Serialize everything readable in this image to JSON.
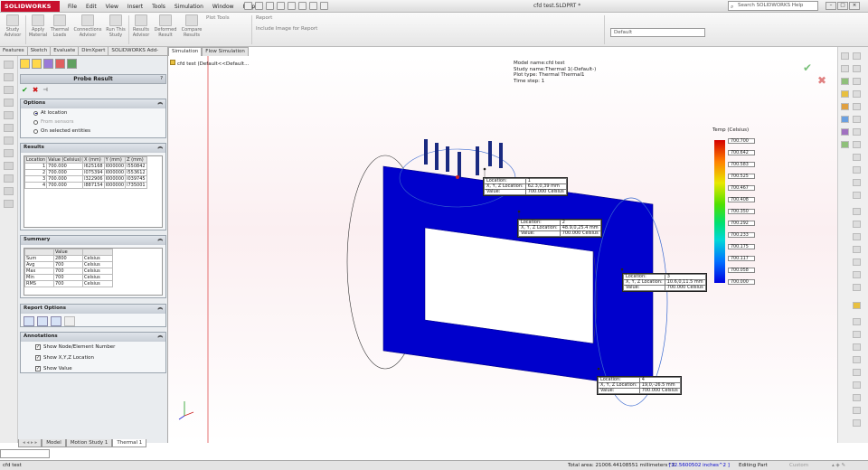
{
  "app": {
    "logo": "SOLIDWORKS",
    "doc_title": "cfd test.SLDPRT *"
  },
  "menu": [
    "File",
    "Edit",
    "View",
    "Insert",
    "Tools",
    "Simulation",
    "Window",
    "Help"
  ],
  "search": {
    "placeholder": "Search SOLIDWORKS Help"
  },
  "ribbon": {
    "buttons": [
      {
        "label": "Study Advisor"
      },
      {
        "label": "Apply Material"
      },
      {
        "label": "Thermal Loads"
      },
      {
        "label": "Connections Advisor"
      },
      {
        "label": "Run This Study"
      },
      {
        "label": "Results Advisor"
      },
      {
        "label": "Deformed Result"
      },
      {
        "label": "Compare Results"
      }
    ],
    "plot_tools": "Plot Tools",
    "report": "Report",
    "include_image": "Include Image for Report",
    "config_combo": "Default"
  },
  "manager_tabs": [
    "Features",
    "Sketch",
    "Evaluate",
    "DimXpert",
    "SOLIDWORKS Add-Ins"
  ],
  "graphics_tabs": [
    "Simulation",
    "Flow Simulation"
  ],
  "panel": {
    "title": "Probe Result",
    "help": "?",
    "ok": "✔",
    "cancel": "✖",
    "pin": "⊣",
    "options": {
      "header": "Options",
      "items": [
        {
          "label": "At location",
          "selected": true,
          "enabled": true
        },
        {
          "label": "From sensors",
          "selected": false,
          "enabled": false
        },
        {
          "label": "On selected entities",
          "selected": false,
          "enabled": true
        }
      ]
    },
    "results": {
      "header": "Results",
      "columns": [
        "Location",
        "Value (Celsius)",
        "X (mm)",
        "Y (mm)",
        "Z (mm)"
      ],
      "rows": [
        [
          "1",
          "700.000",
          "l625168",
          "l000000",
          "l550842"
        ],
        [
          "2",
          "700.000",
          "l075394",
          "l000000",
          "l553612"
        ],
        [
          "3",
          "700.000",
          "l322906",
          "l000000",
          "l039745"
        ],
        [
          "4",
          "700.000",
          "l887154",
          "l000000",
          "l735001"
        ]
      ]
    },
    "summary": {
      "header": "Summary",
      "columns": [
        "",
        "Value",
        ""
      ],
      "rows": [
        [
          "Sum",
          "2800",
          "Celsius"
        ],
        [
          "Avg",
          "700",
          "Celsius"
        ],
        [
          "Max",
          "700",
          "Celsius"
        ],
        [
          "Min",
          "700",
          "Celsius"
        ],
        [
          "RMS",
          "700",
          "Celsius"
        ]
      ]
    },
    "report_options": {
      "header": "Report Options"
    },
    "annotations": {
      "header": "Annotations",
      "items": [
        {
          "label": "Show Node/Element Number",
          "checked": true
        },
        {
          "label": "Show X,Y,Z Location",
          "checked": true
        },
        {
          "label": "Show Value",
          "checked": true
        }
      ]
    }
  },
  "feature_tree": {
    "root": "cfd test",
    "config": "(Default<<Default..."
  },
  "model_info": [
    "Model name:cfd test",
    "Study name:Thermal 1(-Default-)",
    "Plot type: Thermal Thermal1",
    "Time step: 1"
  ],
  "legend": {
    "title": "Temp (Celsius)",
    "values": [
      "700.700",
      "700.642",
      "700.583",
      "700.525",
      "700.467",
      "700.408",
      "700.350",
      "700.292",
      "700.233",
      "700.175",
      "700.117",
      "700.058",
      "700.000"
    ]
  },
  "probes": [
    {
      "location_label": "Location:",
      "location": "1",
      "xyz_label": "X, Y, Z Location:",
      "xyz": "62.3,0,39 mm",
      "value_label": "Value:",
      "value": "700.000",
      "unit": "Celsius"
    },
    {
      "location_label": "Location:",
      "location": "2",
      "xyz_label": "X, Y, Z Location:",
      "xyz": "48.9,0,25.4 mm",
      "value_label": "Value:",
      "value": "700.000",
      "unit": "Celsius"
    },
    {
      "location_label": "Location:",
      "location": "3",
      "xyz_label": "X, Y, Z Location:",
      "xyz": "10.6,0,11.5 mm",
      "value_label": "Value:",
      "value": "700.000",
      "unit": "Celsius"
    },
    {
      "location_label": "Location:",
      "location": "4",
      "xyz_label": "X, Y, Z Location:",
      "xyz": "19,0,-26.5 mm",
      "value_label": "Value:",
      "value": "700.000",
      "unit": "Celsius"
    }
  ],
  "view_tabs": [
    "Model",
    "Motion Study 1",
    "Thermal 1"
  ],
  "status": {
    "left": "cfd test",
    "area_label": "Total area: 21006.44108551 millimeters^2",
    "area_inch": "[32.5600502 inches^2 ]",
    "mode": "Editing Part",
    "custom": "Custom"
  },
  "colors": {
    "mesh": "#0000cc",
    "accent": "#c8102e"
  }
}
